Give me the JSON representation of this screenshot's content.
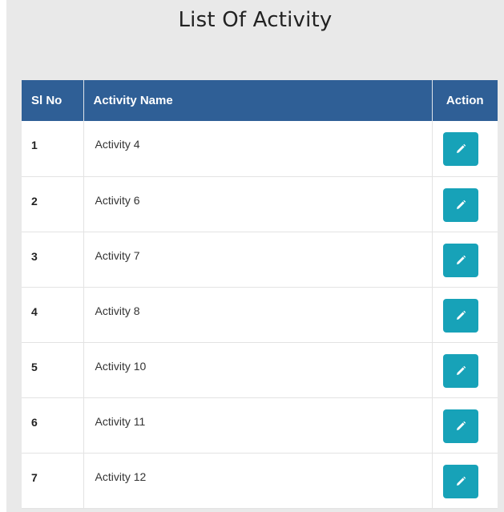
{
  "page": {
    "title": "List Of Activity"
  },
  "table": {
    "headers": {
      "sl_no": "Sl No",
      "activity_name": "Activity Name",
      "action": "Action"
    },
    "rows": [
      {
        "sl": "1",
        "name": "Activity 4"
      },
      {
        "sl": "2",
        "name": "Activity 6"
      },
      {
        "sl": "3",
        "name": "Activity 7"
      },
      {
        "sl": "4",
        "name": "Activity 8"
      },
      {
        "sl": "5",
        "name": "Activity 10"
      },
      {
        "sl": "6",
        "name": "Activity 11"
      },
      {
        "sl": "7",
        "name": "Activity 12"
      }
    ]
  },
  "icons": {
    "action_button": "pencil-icon"
  },
  "colors": {
    "header_bg": "#2f5f96",
    "edit_button": "#17a2b8",
    "panel_bg": "#e9e9e9"
  }
}
